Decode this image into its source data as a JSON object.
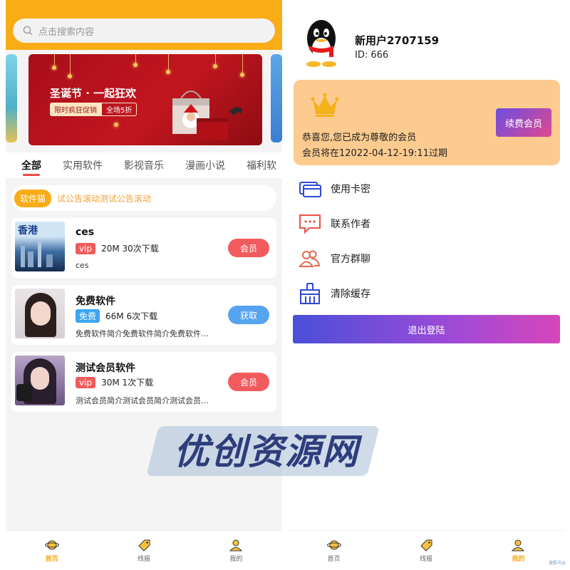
{
  "left": {
    "search": {
      "placeholder": "点击搜索内容"
    },
    "banner": {
      "title": "圣诞节 · 一起狂欢",
      "tag1": "限时疯狂促销",
      "tag2": "全场5折"
    },
    "tabs": [
      "全部",
      "实用软件",
      "影视音乐",
      "漫画小说",
      "福利软"
    ],
    "notice": {
      "badge": "软件猫",
      "text": "试公告滚动测试公告滚动"
    },
    "items": [
      {
        "name": "ces",
        "tag": "vip",
        "size": "20M",
        "downloads": "30次下载",
        "desc": "ces",
        "action": "会员",
        "thumb_text": "香港"
      },
      {
        "name": "免费软件",
        "tag": "免费",
        "size": "66M",
        "downloads": "6次下载",
        "desc": "免费软件简介免费软件简介免费软件…",
        "action": "获取"
      },
      {
        "name": "测试会员软件",
        "tag": "vip",
        "size": "30M",
        "downloads": "1次下载",
        "desc": "测试会员简介测试会员简介测试会员…",
        "action": "会员"
      }
    ],
    "tabbar": [
      {
        "label": "首页",
        "icon": "planet-icon",
        "active": true
      },
      {
        "label": "线报",
        "icon": "tag-icon",
        "active": false
      },
      {
        "label": "我的",
        "icon": "user-icon",
        "active": false
      }
    ]
  },
  "right": {
    "user": {
      "name": "新用户2707159",
      "id": "ID: 666"
    },
    "vip": {
      "line1": "恭喜您,您已成为尊敬的会员",
      "line2": "会员将在12022-04-12-19:11过期",
      "renew": "续费会员"
    },
    "menu": [
      {
        "label": "使用卡密",
        "icon": "card-icon"
      },
      {
        "label": "联系作者",
        "icon": "chat-icon"
      },
      {
        "label": "官方群聊",
        "icon": "group-icon"
      },
      {
        "label": "清除缓存",
        "icon": "broom-icon"
      }
    ],
    "logout": "退出登陆",
    "tabbar": [
      {
        "label": "首页",
        "icon": "planet-icon",
        "active": false
      },
      {
        "label": "线报",
        "icon": "tag-icon",
        "active": false
      },
      {
        "label": "我的",
        "icon": "user-icon",
        "active": true
      }
    ]
  },
  "watermark": "优创资源网",
  "corner": "搜狐号@",
  "colors": {
    "primary": "#f9ac16",
    "vip": "#f25b5d",
    "free": "#3aa6f0",
    "vipcard": "#fdcb8f"
  }
}
